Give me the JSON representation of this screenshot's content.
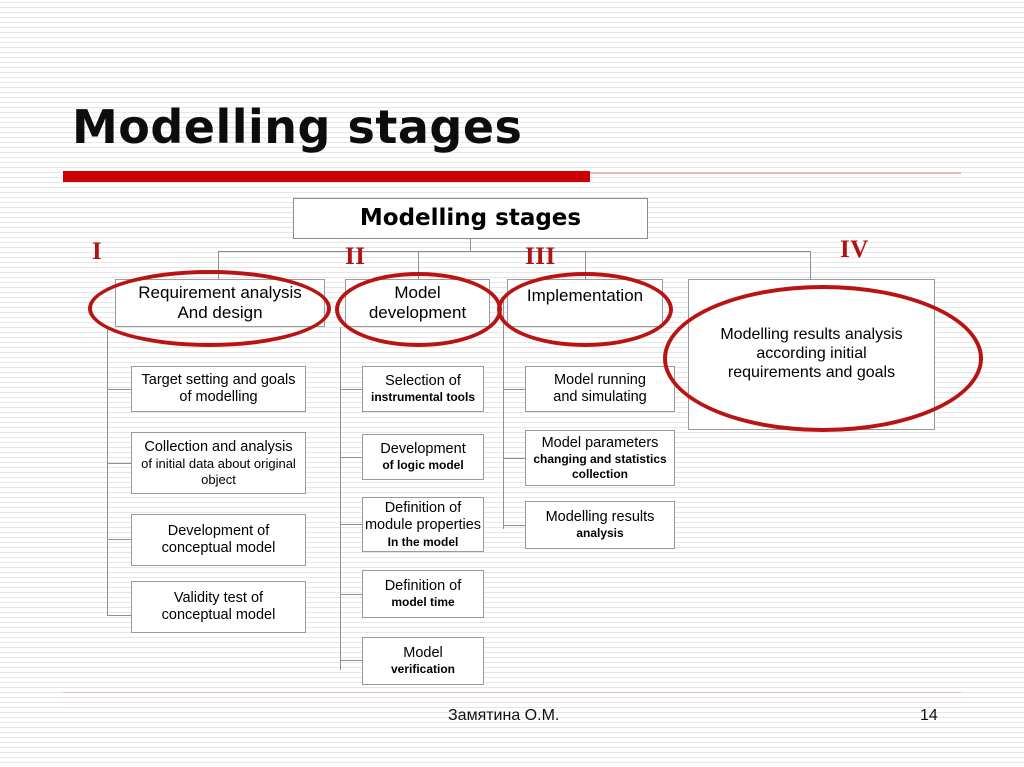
{
  "slide": {
    "title": "Modelling stages",
    "accent_color": "#cc0000",
    "highlight_color": "#b81414",
    "roman_color": "#b21212"
  },
  "diagram": {
    "root": {
      "label": "Modelling stages"
    },
    "numerals": [
      "I",
      "II",
      "III",
      "IV"
    ],
    "columns": [
      {
        "numeral": "I",
        "head": {
          "line1": "Requirement analysis",
          "line2": "And design",
          "highlighted": "true"
        },
        "leaves": [
          {
            "line1": "Target setting and goals",
            "line2": "of modelling",
            "line3": ""
          },
          {
            "line1": "Collection and analysis",
            "line2": "of initial data about original",
            "line3": "object"
          },
          {
            "line1": "Development of",
            "line2": "conceptual model",
            "line3": ""
          },
          {
            "line1": "Validity test of",
            "line2": "conceptual model",
            "line3": ""
          }
        ]
      },
      {
        "numeral": "II",
        "head": {
          "line1": "Model",
          "line2": "development",
          "highlighted": "true"
        },
        "leaves": [
          {
            "line1": "Selection of",
            "line2": "instrumental tools",
            "line3": ""
          },
          {
            "line1": "Development",
            "line2": "of logic model",
            "line3": ""
          },
          {
            "line1": "Definition of",
            "line2": "module properties",
            "line3": "In the model"
          },
          {
            "line1": "Definition of",
            "line2": "model time",
            "line3": ""
          },
          {
            "line1": "Model",
            "line2": "verification",
            "line3": ""
          }
        ]
      },
      {
        "numeral": "III",
        "head": {
          "line1": "Implementation",
          "line2": "",
          "highlighted": "true"
        },
        "leaves": [
          {
            "line1": "Model running",
            "line2": "and simulating",
            "line3": ""
          },
          {
            "line1": "Model parameters",
            "line2": "changing and statistics",
            "line3": "collection"
          },
          {
            "line1": "Modelling results",
            "line2": "analysis",
            "line3": ""
          }
        ]
      },
      {
        "numeral": "IV",
        "head": {
          "line1": "Modelling results analysis",
          "line2": "according initial",
          "line3": "requirements and goals",
          "highlighted": "true"
        },
        "leaves": []
      }
    ]
  },
  "footer": {
    "author": "Замятина О.М.",
    "page": "14"
  }
}
